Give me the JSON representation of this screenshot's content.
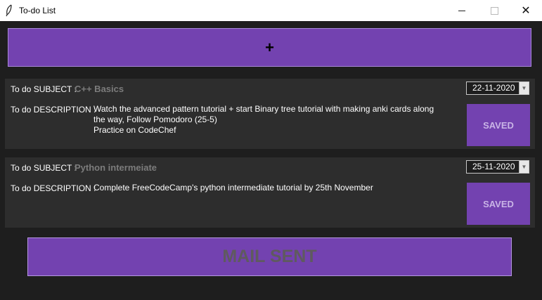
{
  "window": {
    "title": "To-do List",
    "app_icon": "feather-icon",
    "minimize_icon": "minimize-icon",
    "maximize_icon": "maximize-icon",
    "close_glyph": "✕"
  },
  "add_button": {
    "label": "+"
  },
  "todos": [
    {
      "subject_label": "To do SUBJECT :",
      "subject": "C++ Basics",
      "description_label": "To do DESCRIPTION :",
      "description_lines": [
        "Watch the advanced pattern tutorial + start Binary tree tutorial with making anki cards along",
        "the way, Follow Pomodoro (25-5)",
        "Practice on CodeChef"
      ],
      "date": "22-11-2020",
      "status_button": "SAVED"
    },
    {
      "subject_label": "To do SUBJECT :",
      "subject": "Python intermeiate",
      "description_label": "To do DESCRIPTION :",
      "description_lines": [
        "Complete FreeCodeCamp's python intermediate tutorial by 25th November"
      ],
      "date": "25-11-2020",
      "status_button": "SAVED"
    }
  ],
  "mail_button": {
    "label": "MAIL SENT"
  },
  "colors": {
    "background": "#1e1e1e",
    "card": "#2d2d2d",
    "accent": "#7342b0",
    "muted_text": "#7c7c7c"
  }
}
